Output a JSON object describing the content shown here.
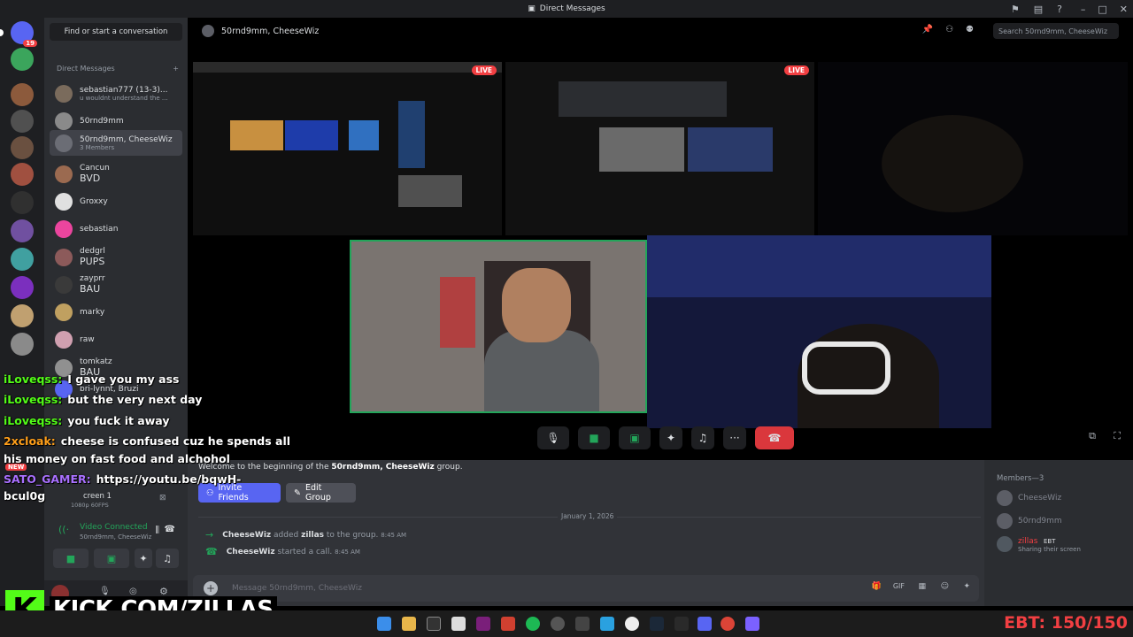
{
  "window": {
    "title": "Direct Messages"
  },
  "rail": {
    "home_badge": "19"
  },
  "sidebar": {
    "find_placeholder": "Find or start a conversation",
    "dm_header": "Direct Messages",
    "add_symbol": "+",
    "dms": [
      {
        "name": "sebastian777 (13-3)...",
        "sub": "u wouldnt understand the ...",
        "tag": "",
        "color": "#7a6b5c"
      },
      {
        "name": "50rnd9mm",
        "sub": "",
        "tag": "",
        "color": "#8a8a8a"
      },
      {
        "name": "50rnd9mm, CheeseWiz",
        "sub": "3 Members",
        "tag": "",
        "color": "#6b6d75"
      },
      {
        "name": "Cancun",
        "sub": "",
        "tag": "BVD",
        "color": "#9b6a50"
      },
      {
        "name": "Groxxy",
        "sub": "",
        "tag": "",
        "color": "#e0e0e0"
      },
      {
        "name": "sebastian",
        "sub": "",
        "tag": "",
        "color": "#eb459e"
      },
      {
        "name": "dedgrl",
        "sub": "",
        "tag": "PUPS",
        "color": "#8c5a5a"
      },
      {
        "name": "zayprr",
        "sub": "",
        "tag": "BAU",
        "color": "#3a3a3a"
      },
      {
        "name": "marky",
        "sub": "",
        "tag": "",
        "color": "#c0a060"
      },
      {
        "name": "raw",
        "sub": "",
        "tag": "",
        "color": "#d0a0b0"
      },
      {
        "name": "tomkatz",
        "sub": "",
        "tag": "BAU",
        "color": "#909090"
      },
      {
        "name": "bri-lynnt, Bruzi",
        "sub": "",
        "tag": "",
        "color": "#5865f2"
      }
    ]
  },
  "voice": {
    "status": "Video Connected",
    "channel": "50rnd9mm, CheeseWiz",
    "screen_label": "creen 1",
    "screen_sub": "1080p 60FPS"
  },
  "header": {
    "channel_name": "50rnd9mm, CheeseWiz",
    "search_placeholder": "Search 50rnd9mm, CheeseWiz"
  },
  "stage": {
    "live_label": "LIVE"
  },
  "chat": {
    "welcome_prefix": "Welcome to the beginning of the ",
    "welcome_group": "50rnd9mm, CheeseWiz",
    "welcome_suffix": " group.",
    "invite_label": "Invite Friends",
    "edit_label": "Edit Group",
    "date": "January 1, 2026",
    "messages": [
      {
        "actor": "CheeseWiz",
        "action": " added ",
        "target": "zillas",
        "rest": " to the group.",
        "time": "8:45 AM"
      },
      {
        "actor": "CheeseWiz",
        "action": " started a call.",
        "target": "",
        "rest": "",
        "time": "8:45 AM"
      }
    ],
    "composer_placeholder": "Message 50rnd9mm, CheeseWiz"
  },
  "members": {
    "header": "Members—3",
    "list": [
      {
        "name": "CheeseWiz",
        "status": ""
      },
      {
        "name": "50rnd9mm",
        "status": ""
      },
      {
        "name": "zillas",
        "tag": "EBT",
        "status": "Sharing their screen"
      }
    ]
  },
  "overlay_chat": [
    {
      "user": "iLoveqss:",
      "text": "I gave you my ass",
      "color": "#53fc18"
    },
    {
      "user": "iLoveqss:",
      "text": "but the very next day",
      "color": "#53fc18"
    },
    {
      "user": "iLoveqss:",
      "text": "you fuck it away",
      "color": "#53fc18"
    },
    {
      "user": "2xcloak:",
      "text": "cheese is confused cuz he spends all",
      "color": "#ff9f1a"
    },
    {
      "user": "",
      "text": "his money on fast food and alchohol",
      "color": "#ffffff"
    },
    {
      "user": "SATO_GAMER:",
      "text": "https://youtu.be/bqwH-",
      "color": "#a970ff"
    },
    {
      "user": "",
      "text": "bcul0g",
      "color": "#ffffff"
    }
  ],
  "new_badge": "NEW",
  "branding": {
    "kick_letter": "K",
    "kick_url": "KICK.COM/ZILLAS"
  },
  "ebt_counter": "EBT: 150/150"
}
